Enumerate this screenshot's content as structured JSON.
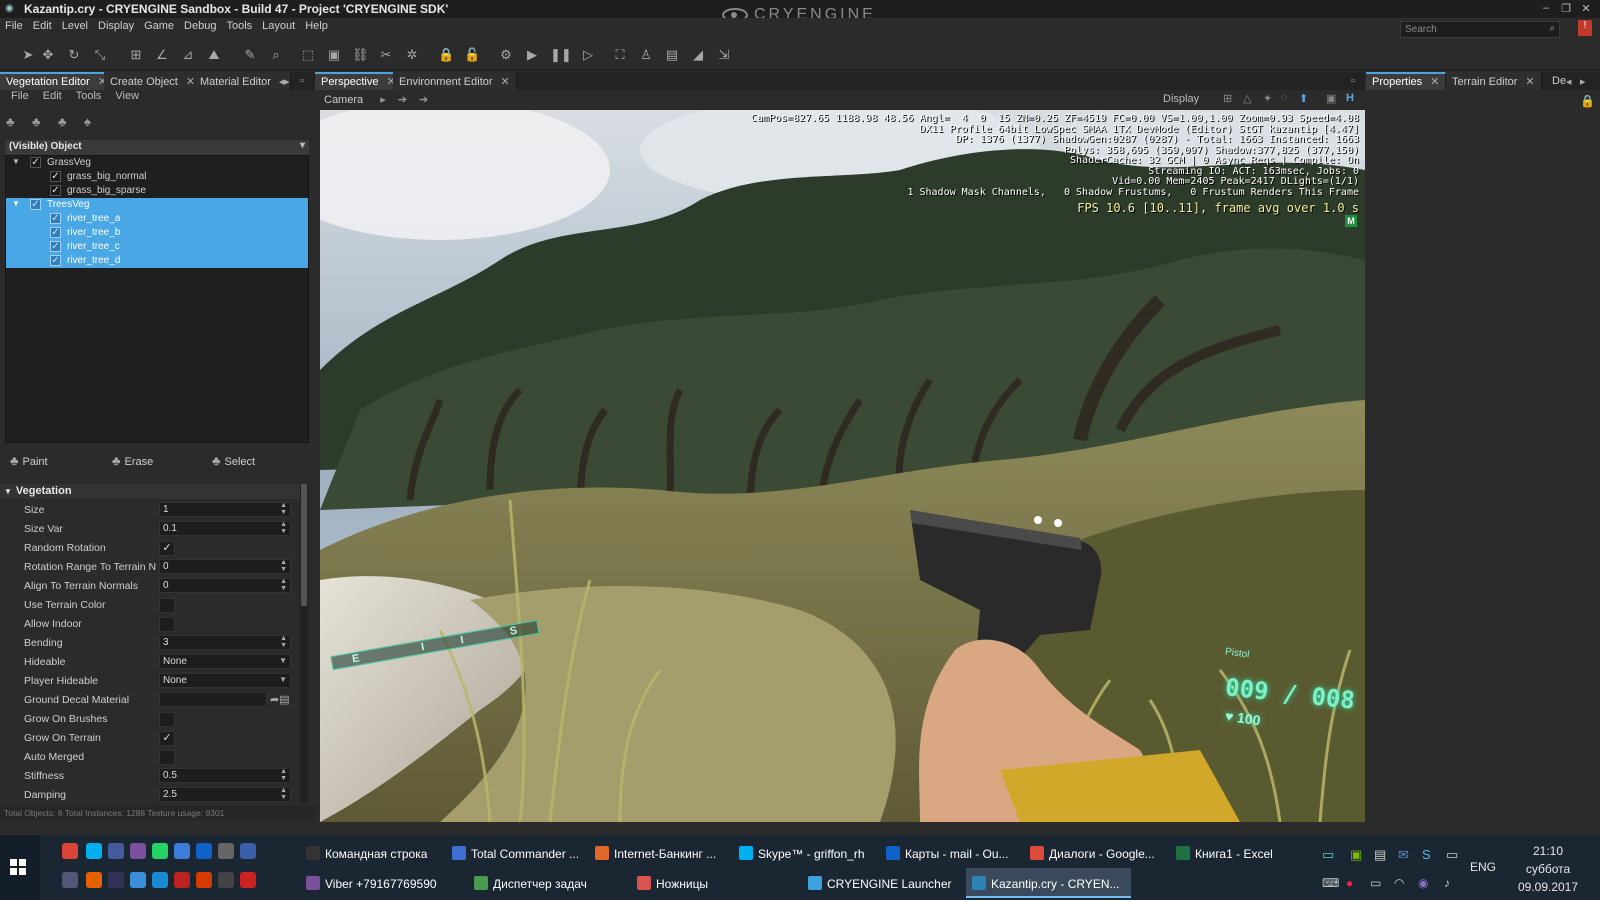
{
  "window": {
    "title": "Kazantip.cry - CRYENGINE Sandbox - Build 47 - Project 'CRYENGINE SDK'",
    "logo": "CRYENGINE"
  },
  "menu": [
    "File",
    "Edit",
    "Level",
    "Display",
    "Game",
    "Debug",
    "Tools",
    "Layout",
    "Help"
  ],
  "search": {
    "placeholder": "Search"
  },
  "left_tabs": [
    "Vegetation Editor",
    "Create Object",
    "Material Editor"
  ],
  "left_menu": [
    "File",
    "Edit",
    "Tools",
    "View"
  ],
  "tree": {
    "header": "(Visible) Object",
    "groups": [
      {
        "name": "GrassVeg",
        "items": [
          "grass_big_normal",
          "grass_big_sparse"
        ]
      },
      {
        "name": "TreesVeg",
        "items": [
          "river_tree_a",
          "river_tree_b",
          "river_tree_c",
          "river_tree_d"
        ]
      }
    ]
  },
  "paint_tools": [
    "Paint",
    "Erase",
    "Select"
  ],
  "vegetation": {
    "header": "Vegetation",
    "props": [
      {
        "label": "Size",
        "type": "num",
        "value": "1"
      },
      {
        "label": "Size Var",
        "type": "num",
        "value": "0.1"
      },
      {
        "label": "Random Rotation",
        "type": "bool",
        "value": "✓"
      },
      {
        "label": "Rotation Range To Terrain N",
        "type": "num",
        "value": "0"
      },
      {
        "label": "Align To Terrain Normals",
        "type": "num",
        "value": "0"
      },
      {
        "label": "Use Terrain Color",
        "type": "bool",
        "value": ""
      },
      {
        "label": "Allow Indoor",
        "type": "bool",
        "value": ""
      },
      {
        "label": "Bending",
        "type": "num",
        "value": "3"
      },
      {
        "label": "Hideable",
        "type": "enum",
        "value": "None"
      },
      {
        "label": "Player Hideable",
        "type": "enum",
        "value": "None"
      },
      {
        "label": "Ground Decal Material",
        "type": "file",
        "value": ""
      },
      {
        "label": "Grow On Brushes",
        "type": "bool",
        "value": ""
      },
      {
        "label": "Grow On Terrain",
        "type": "bool",
        "value": "✓"
      },
      {
        "label": "Auto Merged",
        "type": "bool",
        "value": ""
      },
      {
        "label": "Stiffness",
        "type": "num",
        "value": "0.5"
      },
      {
        "label": "Damping",
        "type": "num",
        "value": "2.5"
      }
    ]
  },
  "status": "Total Objects: 6  Total Instances: 1288  Texture usage: 9301",
  "center_tabs": [
    "Perspective",
    "Environment Editor"
  ],
  "viewport_bar": {
    "camera": "Camera",
    "display": "Display"
  },
  "hud": {
    "lines": "CamPos=827.65 1188.98 48.56 Angl=  4  0  15 ZN=0.25 ZF=4519 FC=0.00 VS=1.00,1.00 Zoom=0.93 Speed=4.08\nDX11 Profile 64bit LowSpec SMAA 1TX DevMode (Editor) StGT kazantip [4.47]\nDP: 1376 (1377) ShadowGen:0287 (0287) - Total: 1663 Instanced: 1663\nPolys: 358,695 (359,097) Shadow:377,825 (377,150)\nShaderCache: 32 GCM | 0 Async Reqs | Compile: On\nStreaming IO: ACT: 163msec, Jobs: 0\nVid=0.00 Mem=2405 Peak=2417 DLights=(1/1)\n1 Shadow Mask Channels,   0 Shadow Frustums,   0 Frustum Renders This Frame",
    "fps": "FPS 10.6 [10..11], frame avg over 1.0 s",
    "mode": "M",
    "weapon": "Pistol",
    "ammo": "009 / 008",
    "health": "100",
    "compass": [
      "E",
      "I",
      "I",
      "S"
    ]
  },
  "right_tabs": [
    "Properties",
    "Terrain Editor",
    "De"
  ],
  "taskbar": {
    "row1": [
      {
        "label": "Командная строка",
        "color": "#333333"
      },
      {
        "label": "Total Commander ...",
        "color": "#3c6fd1"
      },
      {
        "label": "Internet-Банкинг ...",
        "color": "#e0672b"
      },
      {
        "label": "Skype™ - griffon_rh",
        "color": "#00aff0"
      },
      {
        "label": "Карты - mail - Ou...",
        "color": "#0f63c8"
      },
      {
        "label": "Диалоги - Google...",
        "color": "#dd4b39"
      },
      {
        "label": "Книга1 - Excel",
        "color": "#1f7244"
      }
    ],
    "row2": [
      {
        "label": "Viber +79167769590",
        "color": "#7b519d"
      },
      {
        "label": "Диспетчер задач",
        "color": "#4a9b4f"
      },
      {
        "label": "Ножницы",
        "color": "#d9534f"
      },
      {
        "label": "CRYENGINE Launcher",
        "color": "#3da3e0"
      },
      {
        "label": "Kazantip.cry - CRYEN...",
        "color": "#2d82b6"
      }
    ],
    "lang": "ENG",
    "time": "21:10",
    "day": "суббота",
    "date": "09.09.2017"
  }
}
